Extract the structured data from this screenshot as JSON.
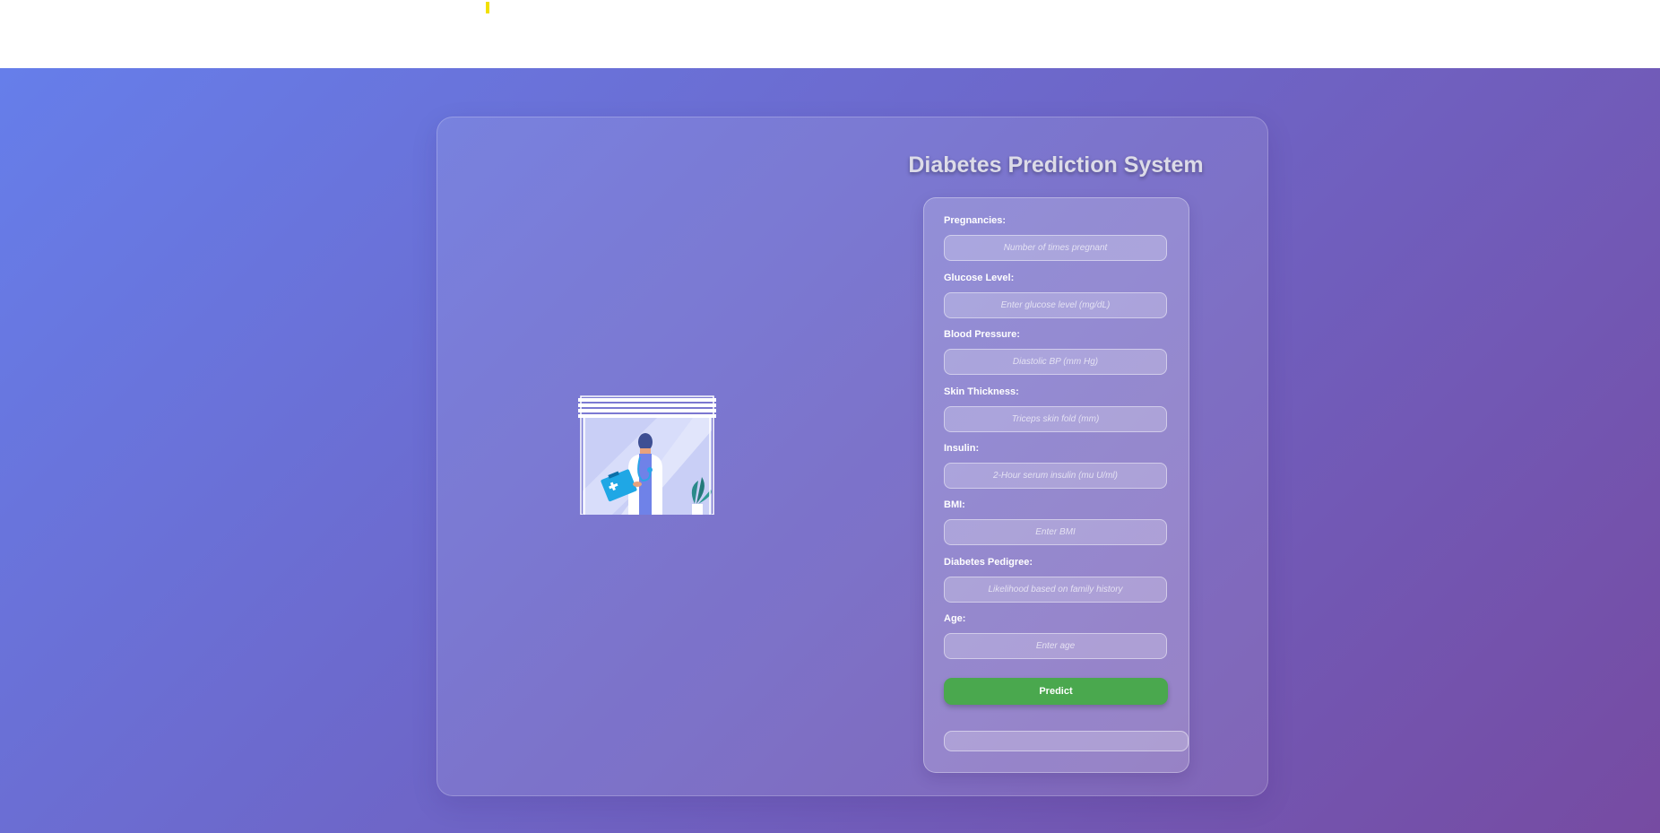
{
  "page": {
    "title": "Diabetes Prediction System",
    "colors": {
      "gradient_start": "#667eea",
      "gradient_end": "#764ba2",
      "predict_button": "#4aa84e",
      "top_marker": "#f2e000"
    }
  },
  "illustration": {
    "icon": "doctor-with-clipboard-illustration"
  },
  "form": {
    "fields": [
      {
        "label": "Pregnancies:",
        "placeholder": "Number of times pregnant"
      },
      {
        "label": "Glucose Level:",
        "placeholder": "Enter glucose level (mg/dL)"
      },
      {
        "label": "Blood Pressure:",
        "placeholder": "Diastolic BP (mm Hg)"
      },
      {
        "label": "Skin Thickness:",
        "placeholder": "Triceps skin fold (mm)"
      },
      {
        "label": "Insulin:",
        "placeholder": "2-Hour serum insulin (mu U/ml)"
      },
      {
        "label": "BMI:",
        "placeholder": "Enter BMI"
      },
      {
        "label": "Diabetes Pedigree:",
        "placeholder": "Likelihood based on family history"
      },
      {
        "label": "Age:",
        "placeholder": "Enter age"
      }
    ],
    "predict_label": "Predict",
    "result_text": ""
  }
}
